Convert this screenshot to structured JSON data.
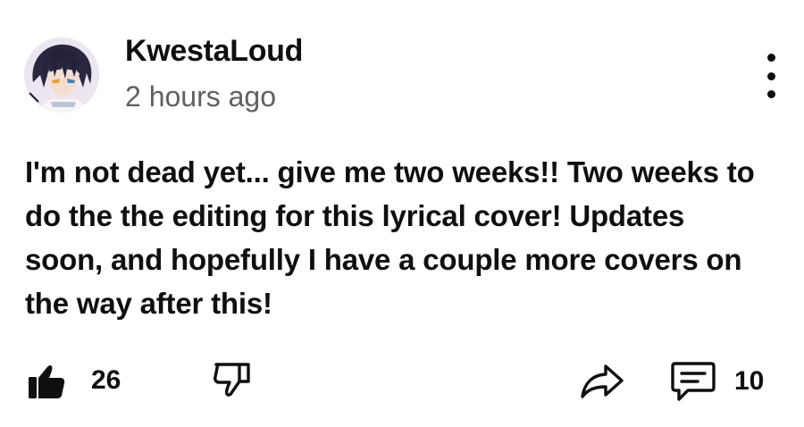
{
  "post": {
    "author": "KwestaLoud",
    "time": "2 hours ago",
    "text": "I'm not dead yet... give me two weeks!! Two weeks to do the the editing for this lyrical cover! Updates soon, and hopefully I have a couple more covers on the way after this!"
  },
  "actions": {
    "like_count": "26",
    "comment_count": "10"
  },
  "icons": {
    "like": "thumbs-up-filled-icon",
    "dislike": "thumbs-down-outline-icon",
    "share": "share-arrow-icon",
    "comment": "comment-bubble-icon",
    "menu": "more-vertical-icon"
  },
  "colors": {
    "text": "#0f0f0f",
    "secondary_text": "#606060",
    "background": "#ffffff"
  }
}
